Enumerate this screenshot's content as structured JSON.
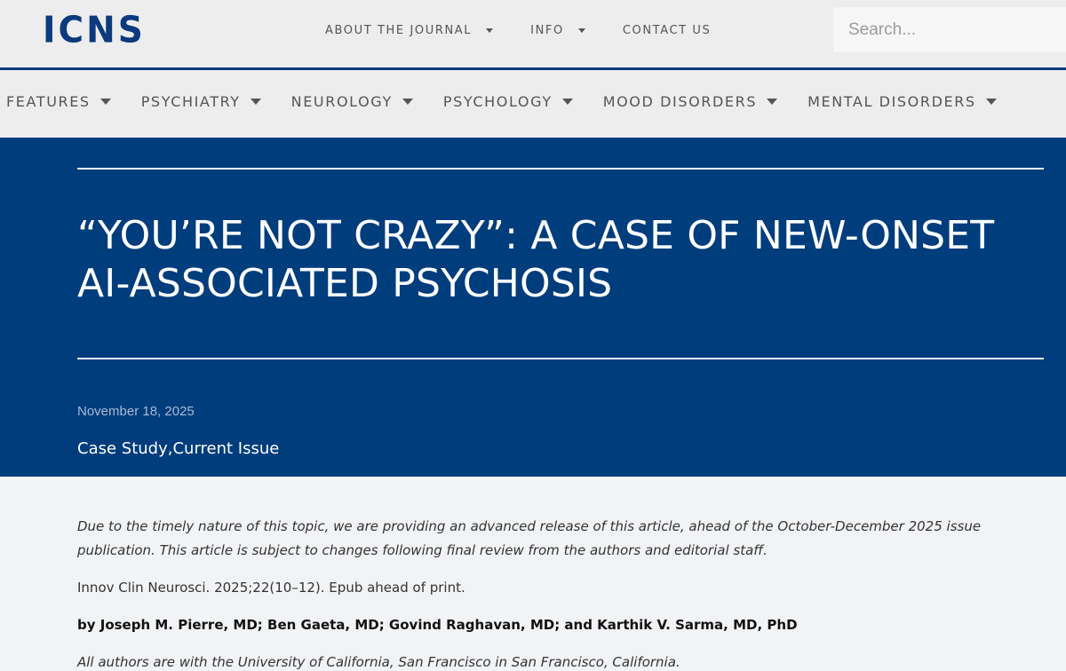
{
  "header": {
    "logo": "ICNS",
    "nav": [
      {
        "label": "ABOUT THE JOURNAL",
        "has_dropdown": true
      },
      {
        "label": "INFO",
        "has_dropdown": true
      },
      {
        "label": "CONTACT US",
        "has_dropdown": false
      }
    ],
    "search_placeholder": "Search..."
  },
  "categories": [
    {
      "label": "FEATURES"
    },
    {
      "label": "PSYCHIATRY"
    },
    {
      "label": "NEUROLOGY"
    },
    {
      "label": "PSYCHOLOGY"
    },
    {
      "label": "MOOD DISORDERS"
    },
    {
      "label": "MENTAL DISORDERS"
    }
  ],
  "article": {
    "title": "“YOU’RE NOT CRAZY”: A CASE OF NEW-ONSET AI-ASSOCIATED PSYCHOSIS",
    "date": "November 18, 2025",
    "categories": "Case Study,Current Issue",
    "notice": "Due to the timely nature of this topic, we are providing an advanced release of this article, ahead of the October-December 2025 issue publication. This article is subject to changes following final review from the authors and editorial staff.",
    "citation": "Innov Clin Neurosci. 2025;22(10–12). Epub ahead of print.",
    "authors": "by Joseph M. Pierre, MD; Ben Gaeta, MD; Govind Raghavan, MD; and Karthik V. Sarma, MD, PhD",
    "affiliation": "All authors are with the University of California, San Francisco in San Francisco, California."
  },
  "colors": {
    "brand_blue": "#003d7d",
    "logo_blue": "#0b3a7e",
    "header_bg": "#ededee",
    "page_bg": "#f2f3f5"
  },
  "icons": {
    "dropdown": "chevron-down-icon"
  }
}
